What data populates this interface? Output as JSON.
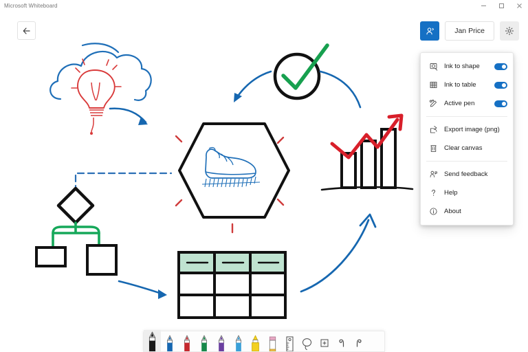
{
  "window": {
    "title": "Microsoft Whiteboard",
    "controls": [
      {
        "name": "minimize",
        "glyph": "minimize-icon"
      },
      {
        "name": "maximize",
        "glyph": "maximize-icon"
      },
      {
        "name": "close",
        "glyph": "close-icon"
      }
    ]
  },
  "header": {
    "back_label": "back-arrow-icon",
    "share_label": "share-person-icon",
    "user_name": "Jan Price",
    "settings_label": "gear-icon"
  },
  "menu": {
    "groups": [
      {
        "items": [
          {
            "icon": "ink-to-shape-icon",
            "label": "Ink to shape",
            "toggle": true,
            "toggle_on": true
          },
          {
            "icon": "ink-to-table-icon",
            "label": "Ink to table",
            "toggle": true,
            "toggle_on": true
          },
          {
            "icon": "active-pen-icon",
            "label": "Active pen",
            "toggle": true,
            "toggle_on": true
          }
        ]
      },
      {
        "items": [
          {
            "icon": "export-image-icon",
            "label": "Export image (png)",
            "toggle": false
          },
          {
            "icon": "clear-canvas-icon",
            "label": "Clear canvas",
            "toggle": false
          }
        ]
      },
      {
        "items": [
          {
            "icon": "send-feedback-icon",
            "label": "Send feedback",
            "toggle": false
          },
          {
            "icon": "help-icon",
            "label": "Help",
            "toggle": false
          },
          {
            "icon": "about-icon",
            "label": "About",
            "toggle": false
          }
        ]
      }
    ]
  },
  "toolbar": {
    "tools": [
      {
        "name": "pen-black",
        "label": "Black pen",
        "type": "pen",
        "color": "#191919",
        "selected": true
      },
      {
        "name": "pen-blue",
        "label": "Blue pen",
        "type": "pen",
        "color": "#1667b0",
        "selected": false
      },
      {
        "name": "pen-red",
        "label": "Red pen",
        "type": "pen",
        "color": "#c4292f",
        "selected": false
      },
      {
        "name": "pen-green",
        "label": "Green pen",
        "type": "pen",
        "color": "#18884a",
        "selected": false
      },
      {
        "name": "pen-purple",
        "label": "Purple pen",
        "type": "pen",
        "color": "#6b3fa0",
        "selected": false
      },
      {
        "name": "pen-lightblue",
        "label": "Light blue pen",
        "type": "pen",
        "color": "#3aa0d8",
        "selected": false
      },
      {
        "name": "highlighter-yellow",
        "label": "Highlighter",
        "type": "highlighter",
        "color": "#f2d022",
        "selected": false
      },
      {
        "name": "eraser",
        "label": "Eraser",
        "type": "eraser",
        "color": "#e8a8c4",
        "selected": false
      },
      {
        "name": "ruler",
        "label": "Ruler",
        "type": "ruler",
        "color": "#4a4a4a",
        "selected": false
      },
      {
        "name": "lasso-select",
        "label": "Lasso select",
        "type": "lasso",
        "color": "#4a4a4a",
        "selected": false
      },
      {
        "name": "insert",
        "label": "Insert",
        "type": "insert",
        "color": "#4a4a4a",
        "selected": false
      },
      {
        "name": "undo",
        "label": "Undo",
        "type": "undo",
        "color": "#4a4a4a",
        "selected": false
      },
      {
        "name": "redo",
        "label": "Redo",
        "type": "redo",
        "color": "#4a4a4a",
        "selected": false
      }
    ]
  },
  "canvas": {
    "objects": [
      {
        "name": "cloud-sketch",
        "description": "Blue hand-drawn cloud",
        "color": "#1f6fb8"
      },
      {
        "name": "lightbulb-sketch",
        "description": "Red hand-drawn lightbulb with rays",
        "color": "#d93a3a"
      },
      {
        "name": "arrow-cloud-to-hexagon",
        "description": "Blue curved arrow",
        "color": "#1667b0"
      },
      {
        "name": "hexagon-shape",
        "description": "Black hexagon outline",
        "color": "#111111"
      },
      {
        "name": "shoe-sketch",
        "description": "Blue sneaker drawing inside hexagon",
        "color": "#1f6fb8"
      },
      {
        "name": "hexagon-rays",
        "description": "Red radiating dashes around hexagon",
        "color": "#cf3b3b"
      },
      {
        "name": "check-circle",
        "description": "Black circle with green check mark",
        "color": "#111111"
      },
      {
        "name": "check-mark",
        "description": "Green check mark",
        "color": "#17a04f"
      },
      {
        "name": "arrow-check-to-hexagon",
        "description": "Blue curved arrow pointing down-left",
        "color": "#1667b0"
      },
      {
        "name": "arrow-hexagon-to-chart",
        "description": "Blue curved arrow pointing right",
        "color": "#1667b0"
      },
      {
        "name": "bar-chart-sketch",
        "description": "Three black bars with red rising arrow",
        "color": "#111111"
      },
      {
        "name": "trend-arrow",
        "description": "Red zig-zag rising arrow",
        "color": "#d81f2a"
      },
      {
        "name": "flowchart-dashed-line",
        "description": "Blue dashed connector",
        "color": "#2a6fb5"
      },
      {
        "name": "flowchart-diamond",
        "description": "Black diamond node",
        "color": "#111111"
      },
      {
        "name": "flowchart-connector",
        "description": "Green branch connector",
        "color": "#16a85a"
      },
      {
        "name": "flowchart-box-left",
        "description": "Black rectangle node",
        "color": "#111111"
      },
      {
        "name": "flowchart-box-right",
        "description": "Black square node",
        "color": "#111111"
      },
      {
        "name": "arrow-flow-to-table",
        "description": "Blue curved arrow pointing right",
        "color": "#1667b0"
      },
      {
        "name": "table-sketch",
        "description": "3x3 table with mint header row",
        "color": "#111111",
        "header_fill": "#bfe3d0"
      },
      {
        "name": "arrow-table-to-chart",
        "description": "Blue curved arrow pointing up-right",
        "color": "#1667b0"
      }
    ]
  }
}
